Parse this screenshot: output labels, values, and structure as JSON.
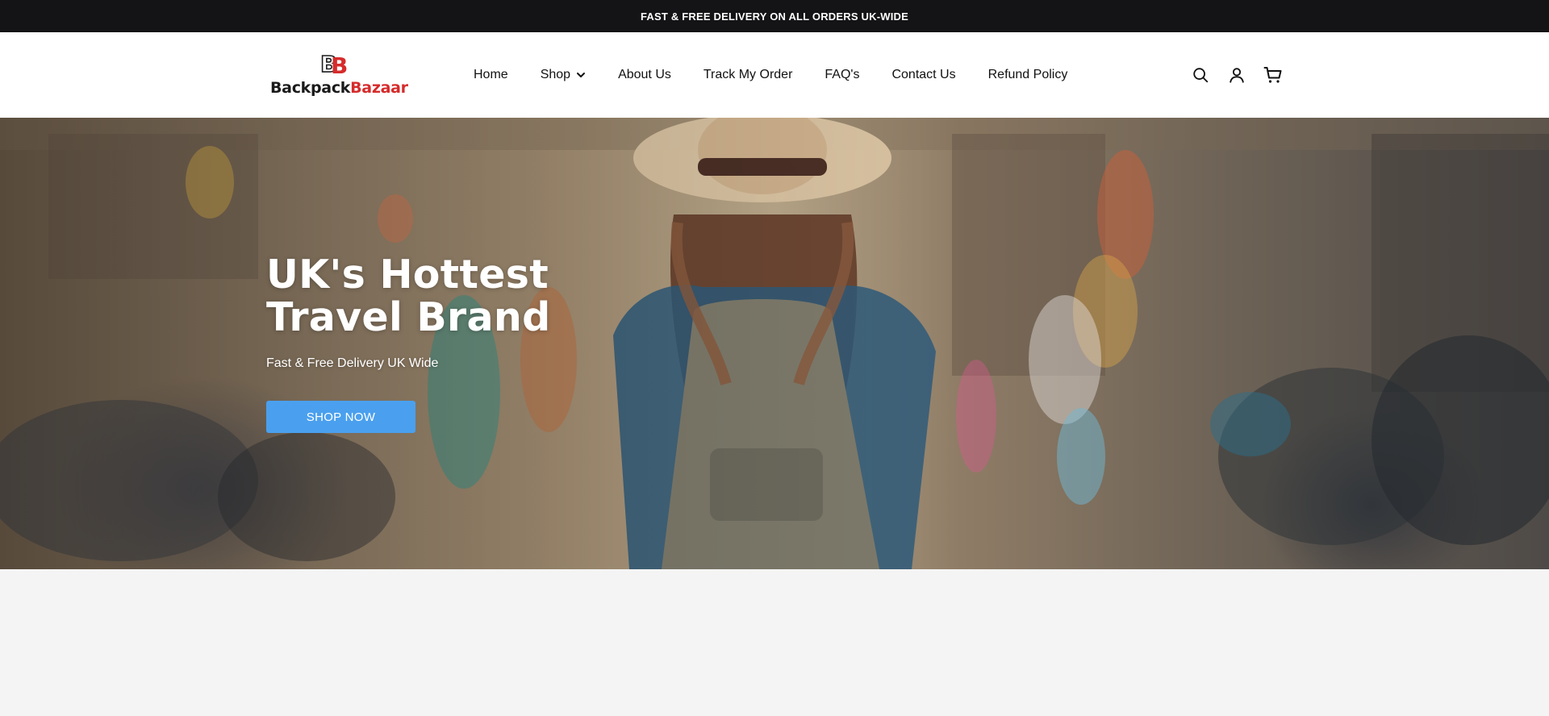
{
  "announcement": {
    "text": "FAST & FREE DELIVERY ON ALL ORDERS UK-WIDE"
  },
  "brand": {
    "name_part1": "Backpack",
    "name_part2": "Bazaar",
    "monogram": "BB",
    "colors": {
      "dark": "#1a1a1a",
      "accent": "#d62b2b"
    }
  },
  "nav": {
    "items": [
      {
        "label": "Home"
      },
      {
        "label": "Shop",
        "has_dropdown": true
      },
      {
        "label": "About Us"
      },
      {
        "label": "Track My Order"
      },
      {
        "label": "FAQ's"
      },
      {
        "label": "Contact Us"
      },
      {
        "label": "Refund Policy"
      }
    ]
  },
  "header_icons": [
    "search-icon",
    "account-icon",
    "cart-icon"
  ],
  "hero": {
    "title_line1": "UK's Hottest",
    "title_line2": "Travel Brand",
    "subtitle": "Fast & Free Delivery UK Wide",
    "cta_label": "SHOP NOW",
    "cta_color": "#4aa0ee",
    "image_subject": "traveller-with-backpack-in-market-street"
  },
  "colors": {
    "announcement_bg": "#141417",
    "page_bg": "#f4f4f4"
  }
}
